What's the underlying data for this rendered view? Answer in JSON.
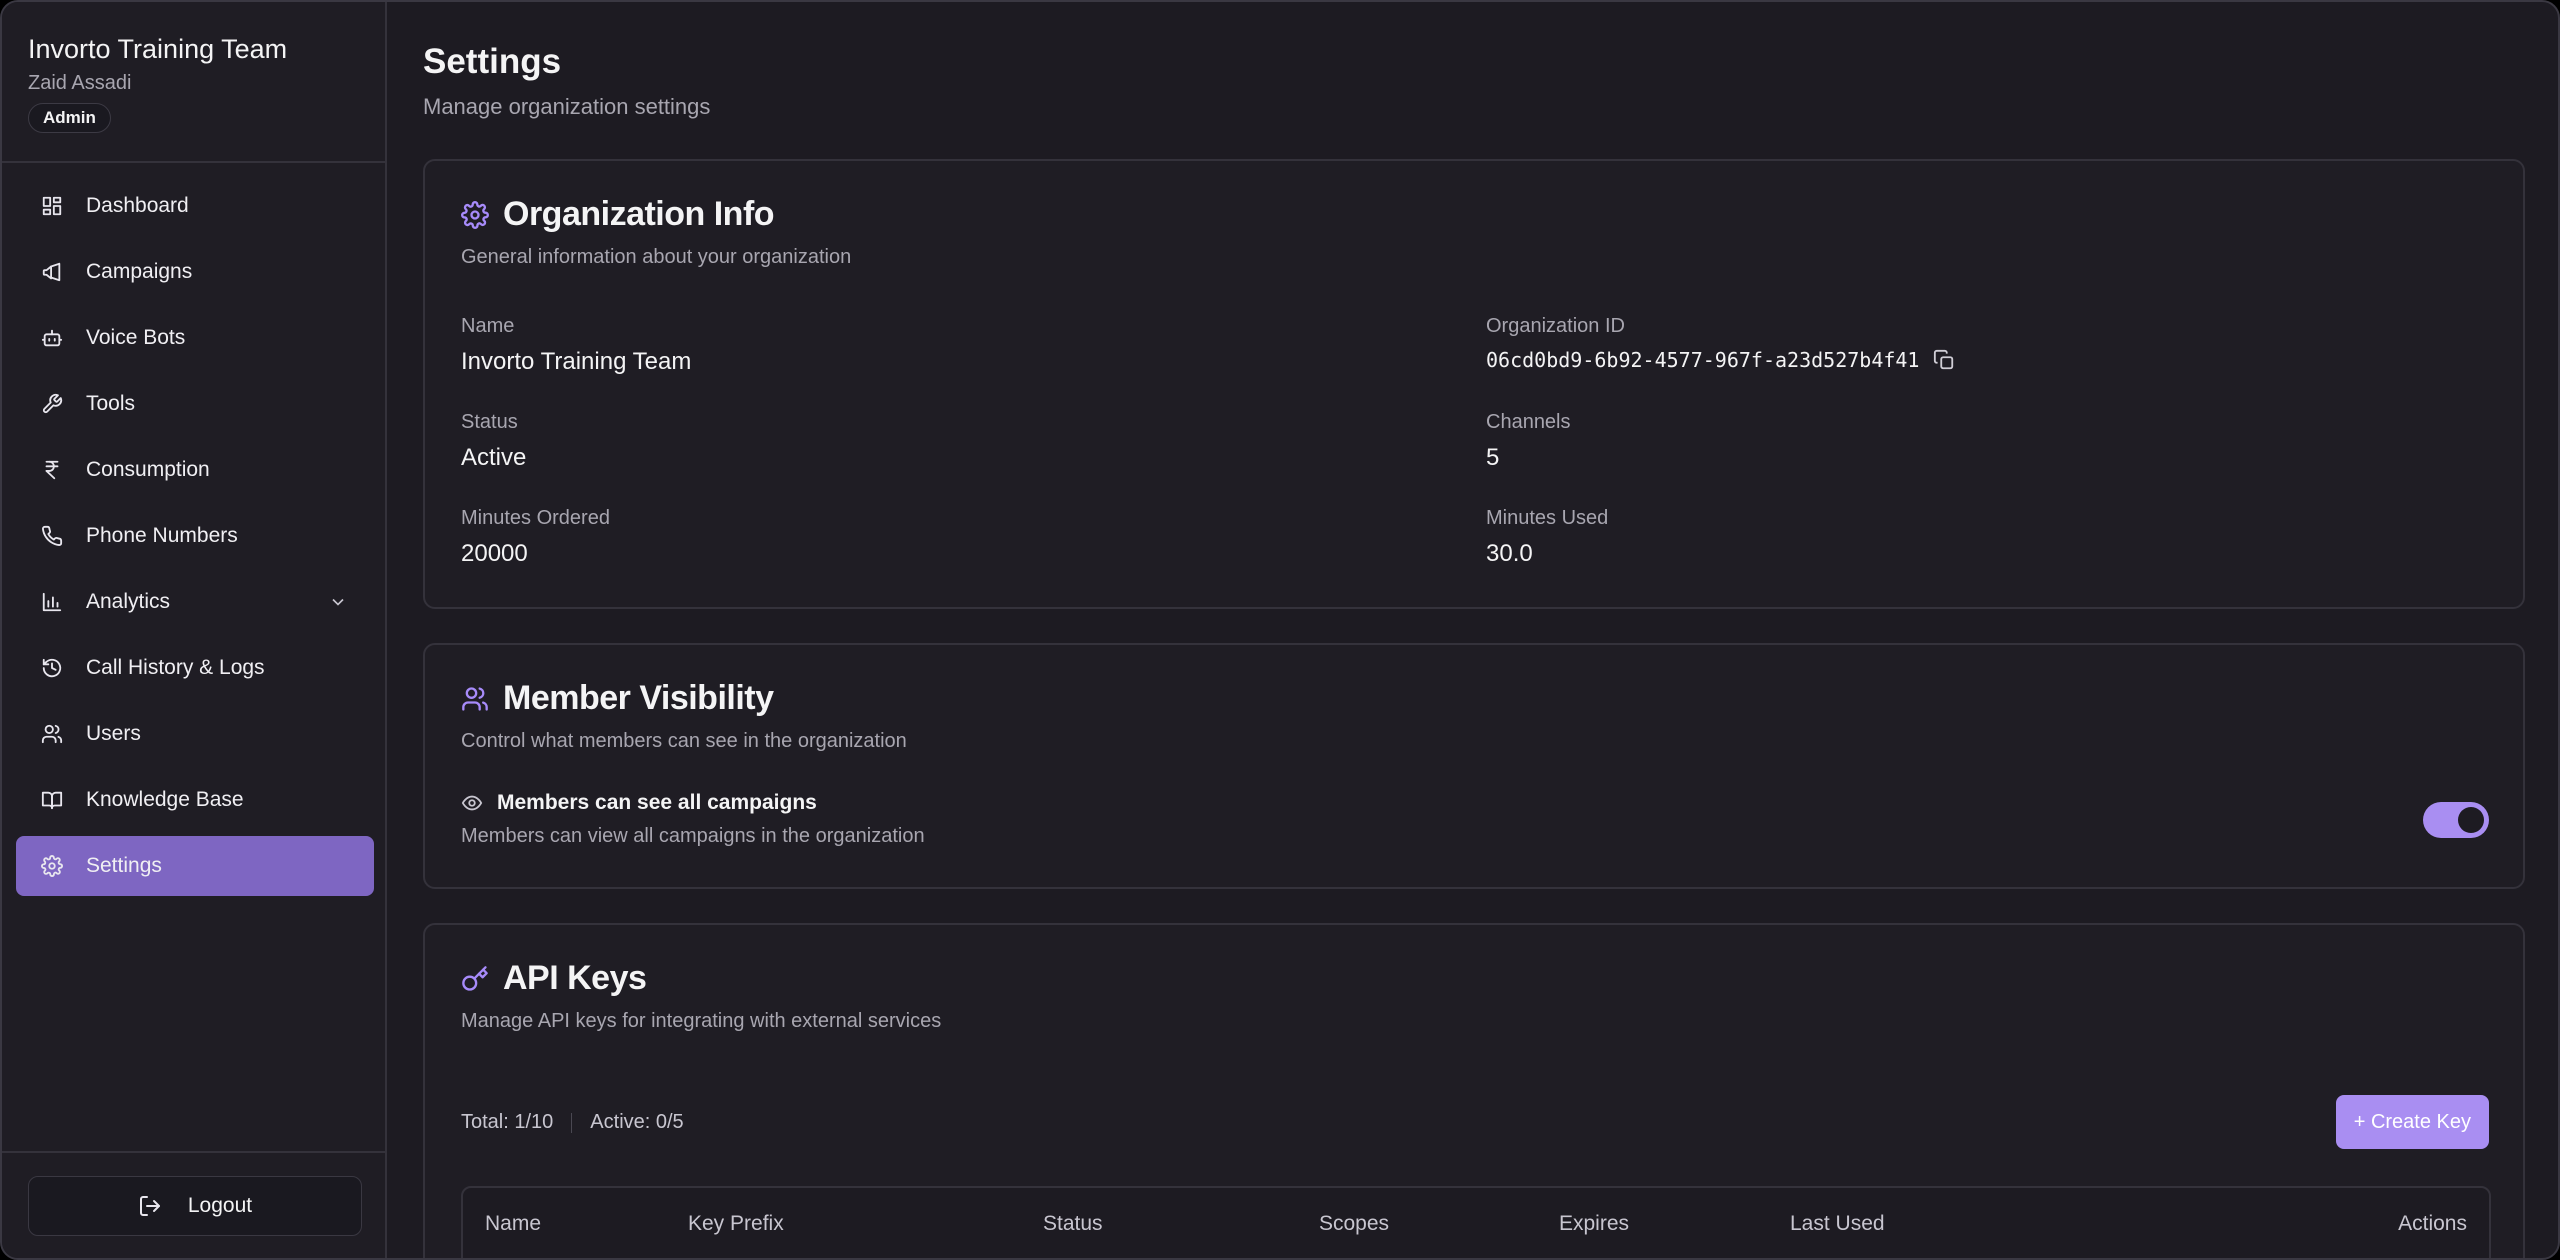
{
  "sidebar": {
    "org_name": "Invorto Training Team",
    "user_name": "Zaid Assadi",
    "role": "Admin",
    "items": [
      {
        "label": "Dashboard",
        "icon": "dashboard-icon"
      },
      {
        "label": "Campaigns",
        "icon": "megaphone-icon"
      },
      {
        "label": "Voice Bots",
        "icon": "bot-icon"
      },
      {
        "label": "Tools",
        "icon": "wrench-icon"
      },
      {
        "label": "Consumption",
        "icon": "rupee-icon"
      },
      {
        "label": "Phone Numbers",
        "icon": "phone-icon"
      },
      {
        "label": "Analytics",
        "icon": "bar-chart-icon",
        "expandable": true
      },
      {
        "label": "Call History & Logs",
        "icon": "history-icon"
      },
      {
        "label": "Users",
        "icon": "users-icon"
      },
      {
        "label": "Knowledge Base",
        "icon": "book-icon"
      },
      {
        "label": "Settings",
        "icon": "gear-icon",
        "active": true
      }
    ],
    "logout_label": "Logout"
  },
  "page": {
    "title": "Settings",
    "subtitle": "Manage organization settings"
  },
  "org_info": {
    "title": "Organization Info",
    "description": "General information about your organization",
    "fields": {
      "name_label": "Name",
      "name_value": "Invorto Training Team",
      "org_id_label": "Organization ID",
      "org_id_value": "06cd0bd9-6b92-4577-967f-a23d527b4f41",
      "status_label": "Status",
      "status_value": "Active",
      "channels_label": "Channels",
      "channels_value": "5",
      "minutes_ordered_label": "Minutes Ordered",
      "minutes_ordered_value": "20000",
      "minutes_used_label": "Minutes Used",
      "minutes_used_value": "30.0"
    }
  },
  "member_visibility": {
    "title": "Member Visibility",
    "description": "Control what members can see in the organization",
    "setting_title": "Members can see all campaigns",
    "setting_description": "Members can view all campaigns in the organization",
    "enabled": true
  },
  "api_keys": {
    "title": "API Keys",
    "description": "Manage API keys for integrating with external services",
    "total": "Total: 1/10",
    "active": "Active: 0/5",
    "create_label": "+ Create Key",
    "columns": [
      "Name",
      "Key Prefix",
      "Status",
      "Scopes",
      "Expires",
      "Last Used",
      "Actions"
    ]
  },
  "colors": {
    "accent": "#a98ef2",
    "active_nav": "#7e66c2",
    "background": "#1d1b22"
  }
}
